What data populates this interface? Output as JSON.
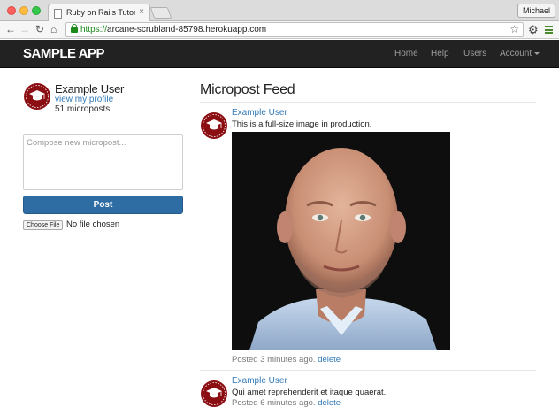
{
  "browser": {
    "tab_title": "Ruby on Rails Tutorial Sam",
    "tab_close": "×",
    "profile_name": "Michael",
    "url_scheme": "https://",
    "url_rest": "arcane-scrubland-85798.herokuapp.com",
    "icons": [
      "back-icon",
      "forward-icon",
      "reload-icon",
      "home-icon",
      "lock-icon",
      "bookmark-star-icon",
      "extension-icon",
      "menu-icon"
    ]
  },
  "navbar": {
    "logo": "SAMPLE APP",
    "links": {
      "home": "Home",
      "help": "Help",
      "users": "Users",
      "account": "Account"
    }
  },
  "sidebar": {
    "user_name": "Example User",
    "profile_link": "view my profile",
    "micropost_count": "51 microposts",
    "compose_placeholder": "Compose new micropost...",
    "post_button": "Post",
    "file_button": "Choose File",
    "file_status": "No file chosen"
  },
  "feed": {
    "title": "Micropost Feed",
    "posts": [
      {
        "user": "Example User",
        "content": "This is a full-size image in production.",
        "time": "Posted 3 minutes ago.",
        "delete": "delete"
      },
      {
        "user": "Example User",
        "content": "Qui amet reprehenderit et itaque quaerat.",
        "time": "Posted 6 minutes ago.",
        "delete": "delete"
      }
    ]
  },
  "colors": {
    "navbar_bg": "#222222",
    "link": "#337ab7",
    "post_button": "#2e6da4",
    "gravatar_red": "#8b0e12"
  }
}
